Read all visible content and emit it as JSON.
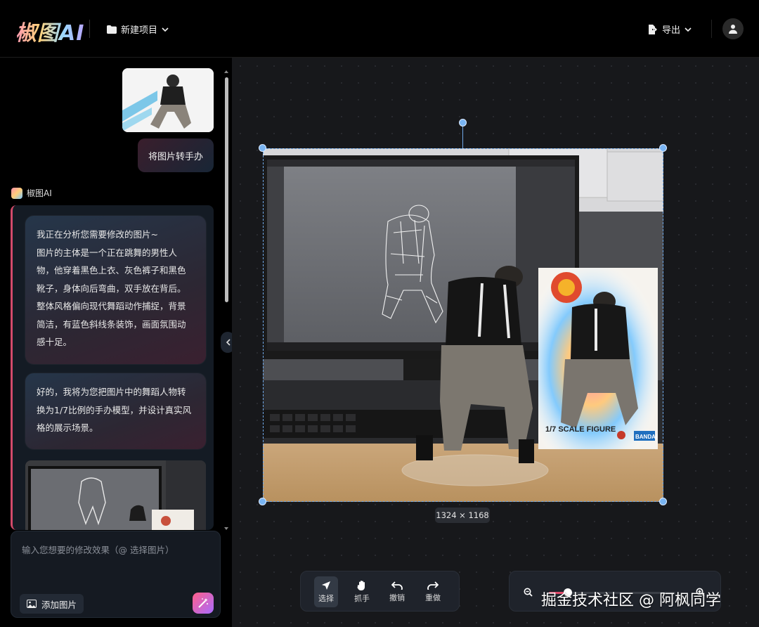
{
  "header": {
    "logo": "椒图AI",
    "project_label": "新建项目",
    "export_label": "导出"
  },
  "chat": {
    "user_message": "将图片转手办",
    "ai_name": "椒图AI",
    "ai_message_1_lines": [
      "我正在分析您需要修改的图片~",
      "图片的主体是一个正在跳舞的男性人",
      "物，他穿着黑色上衣、灰色裤子和黑色",
      "靴子，身体向后弯曲，双手放在背后。",
      "整体风格偏向现代舞蹈动作捕捉，背景",
      "简洁，有蓝色斜线条装饰，画面氛围动",
      "感十足。"
    ],
    "ai_message_2_lines": [
      "好的，我将为您把图片中的舞蹈人物转",
      "换为1/7比例的手办模型，并设计真实风",
      "格的展示场景。"
    ]
  },
  "input": {
    "placeholder": "输入您想要的修改效果（@ 选择图片）",
    "add_image_label": "添加图片"
  },
  "canvas": {
    "dimensions": "1324 × 1168",
    "box_text": "1/7 SCALE FIGURE",
    "brand": "BANDAI"
  },
  "toolbar": {
    "tools": [
      {
        "label": "选择",
        "icon": "cursor-arrow-icon",
        "active": true
      },
      {
        "label": "抓手",
        "icon": "hand-icon",
        "active": false
      },
      {
        "label": "撤销",
        "icon": "undo-icon",
        "active": false
      },
      {
        "label": "重做",
        "icon": "redo-icon",
        "active": false
      }
    ]
  },
  "zoom": {
    "level_fraction": 0.15
  },
  "watermark": "掘金技术社区 @ 阿枫同学",
  "colors": {
    "accent": "#e24a6b",
    "selection": "#6fa8e8",
    "canvas_bg": "#17181b"
  }
}
